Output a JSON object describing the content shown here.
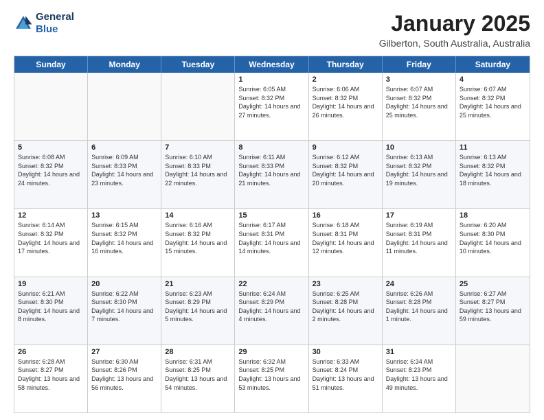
{
  "header": {
    "logo_line1": "General",
    "logo_line2": "Blue",
    "month": "January 2025",
    "location": "Gilberton, South Australia, Australia"
  },
  "weekdays": [
    "Sunday",
    "Monday",
    "Tuesday",
    "Wednesday",
    "Thursday",
    "Friday",
    "Saturday"
  ],
  "weeks": [
    [
      {
        "date": "",
        "sunrise": "",
        "sunset": "",
        "daylight": ""
      },
      {
        "date": "",
        "sunrise": "",
        "sunset": "",
        "daylight": ""
      },
      {
        "date": "",
        "sunrise": "",
        "sunset": "",
        "daylight": ""
      },
      {
        "date": "1",
        "sunrise": "Sunrise: 6:05 AM",
        "sunset": "Sunset: 8:32 PM",
        "daylight": "Daylight: 14 hours and 27 minutes."
      },
      {
        "date": "2",
        "sunrise": "Sunrise: 6:06 AM",
        "sunset": "Sunset: 8:32 PM",
        "daylight": "Daylight: 14 hours and 26 minutes."
      },
      {
        "date": "3",
        "sunrise": "Sunrise: 6:07 AM",
        "sunset": "Sunset: 8:32 PM",
        "daylight": "Daylight: 14 hours and 25 minutes."
      },
      {
        "date": "4",
        "sunrise": "Sunrise: 6:07 AM",
        "sunset": "Sunset: 8:32 PM",
        "daylight": "Daylight: 14 hours and 25 minutes."
      }
    ],
    [
      {
        "date": "5",
        "sunrise": "Sunrise: 6:08 AM",
        "sunset": "Sunset: 8:32 PM",
        "daylight": "Daylight: 14 hours and 24 minutes."
      },
      {
        "date": "6",
        "sunrise": "Sunrise: 6:09 AM",
        "sunset": "Sunset: 8:33 PM",
        "daylight": "Daylight: 14 hours and 23 minutes."
      },
      {
        "date": "7",
        "sunrise": "Sunrise: 6:10 AM",
        "sunset": "Sunset: 8:33 PM",
        "daylight": "Daylight: 14 hours and 22 minutes."
      },
      {
        "date": "8",
        "sunrise": "Sunrise: 6:11 AM",
        "sunset": "Sunset: 8:33 PM",
        "daylight": "Daylight: 14 hours and 21 minutes."
      },
      {
        "date": "9",
        "sunrise": "Sunrise: 6:12 AM",
        "sunset": "Sunset: 8:32 PM",
        "daylight": "Daylight: 14 hours and 20 minutes."
      },
      {
        "date": "10",
        "sunrise": "Sunrise: 6:13 AM",
        "sunset": "Sunset: 8:32 PM",
        "daylight": "Daylight: 14 hours and 19 minutes."
      },
      {
        "date": "11",
        "sunrise": "Sunrise: 6:13 AM",
        "sunset": "Sunset: 8:32 PM",
        "daylight": "Daylight: 14 hours and 18 minutes."
      }
    ],
    [
      {
        "date": "12",
        "sunrise": "Sunrise: 6:14 AM",
        "sunset": "Sunset: 8:32 PM",
        "daylight": "Daylight: 14 hours and 17 minutes."
      },
      {
        "date": "13",
        "sunrise": "Sunrise: 6:15 AM",
        "sunset": "Sunset: 8:32 PM",
        "daylight": "Daylight: 14 hours and 16 minutes."
      },
      {
        "date": "14",
        "sunrise": "Sunrise: 6:16 AM",
        "sunset": "Sunset: 8:32 PM",
        "daylight": "Daylight: 14 hours and 15 minutes."
      },
      {
        "date": "15",
        "sunrise": "Sunrise: 6:17 AM",
        "sunset": "Sunset: 8:31 PM",
        "daylight": "Daylight: 14 hours and 14 minutes."
      },
      {
        "date": "16",
        "sunrise": "Sunrise: 6:18 AM",
        "sunset": "Sunset: 8:31 PM",
        "daylight": "Daylight: 14 hours and 12 minutes."
      },
      {
        "date": "17",
        "sunrise": "Sunrise: 6:19 AM",
        "sunset": "Sunset: 8:31 PM",
        "daylight": "Daylight: 14 hours and 11 minutes."
      },
      {
        "date": "18",
        "sunrise": "Sunrise: 6:20 AM",
        "sunset": "Sunset: 8:30 PM",
        "daylight": "Daylight: 14 hours and 10 minutes."
      }
    ],
    [
      {
        "date": "19",
        "sunrise": "Sunrise: 6:21 AM",
        "sunset": "Sunset: 8:30 PM",
        "daylight": "Daylight: 14 hours and 8 minutes."
      },
      {
        "date": "20",
        "sunrise": "Sunrise: 6:22 AM",
        "sunset": "Sunset: 8:30 PM",
        "daylight": "Daylight: 14 hours and 7 minutes."
      },
      {
        "date": "21",
        "sunrise": "Sunrise: 6:23 AM",
        "sunset": "Sunset: 8:29 PM",
        "daylight": "Daylight: 14 hours and 5 minutes."
      },
      {
        "date": "22",
        "sunrise": "Sunrise: 6:24 AM",
        "sunset": "Sunset: 8:29 PM",
        "daylight": "Daylight: 14 hours and 4 minutes."
      },
      {
        "date": "23",
        "sunrise": "Sunrise: 6:25 AM",
        "sunset": "Sunset: 8:28 PM",
        "daylight": "Daylight: 14 hours and 2 minutes."
      },
      {
        "date": "24",
        "sunrise": "Sunrise: 6:26 AM",
        "sunset": "Sunset: 8:28 PM",
        "daylight": "Daylight: 14 hours and 1 minute."
      },
      {
        "date": "25",
        "sunrise": "Sunrise: 6:27 AM",
        "sunset": "Sunset: 8:27 PM",
        "daylight": "Daylight: 13 hours and 59 minutes."
      }
    ],
    [
      {
        "date": "26",
        "sunrise": "Sunrise: 6:28 AM",
        "sunset": "Sunset: 8:27 PM",
        "daylight": "Daylight: 13 hours and 58 minutes."
      },
      {
        "date": "27",
        "sunrise": "Sunrise: 6:30 AM",
        "sunset": "Sunset: 8:26 PM",
        "daylight": "Daylight: 13 hours and 56 minutes."
      },
      {
        "date": "28",
        "sunrise": "Sunrise: 6:31 AM",
        "sunset": "Sunset: 8:25 PM",
        "daylight": "Daylight: 13 hours and 54 minutes."
      },
      {
        "date": "29",
        "sunrise": "Sunrise: 6:32 AM",
        "sunset": "Sunset: 8:25 PM",
        "daylight": "Daylight: 13 hours and 53 minutes."
      },
      {
        "date": "30",
        "sunrise": "Sunrise: 6:33 AM",
        "sunset": "Sunset: 8:24 PM",
        "daylight": "Daylight: 13 hours and 51 minutes."
      },
      {
        "date": "31",
        "sunrise": "Sunrise: 6:34 AM",
        "sunset": "Sunset: 8:23 PM",
        "daylight": "Daylight: 13 hours and 49 minutes."
      },
      {
        "date": "",
        "sunrise": "",
        "sunset": "",
        "daylight": ""
      }
    ]
  ]
}
